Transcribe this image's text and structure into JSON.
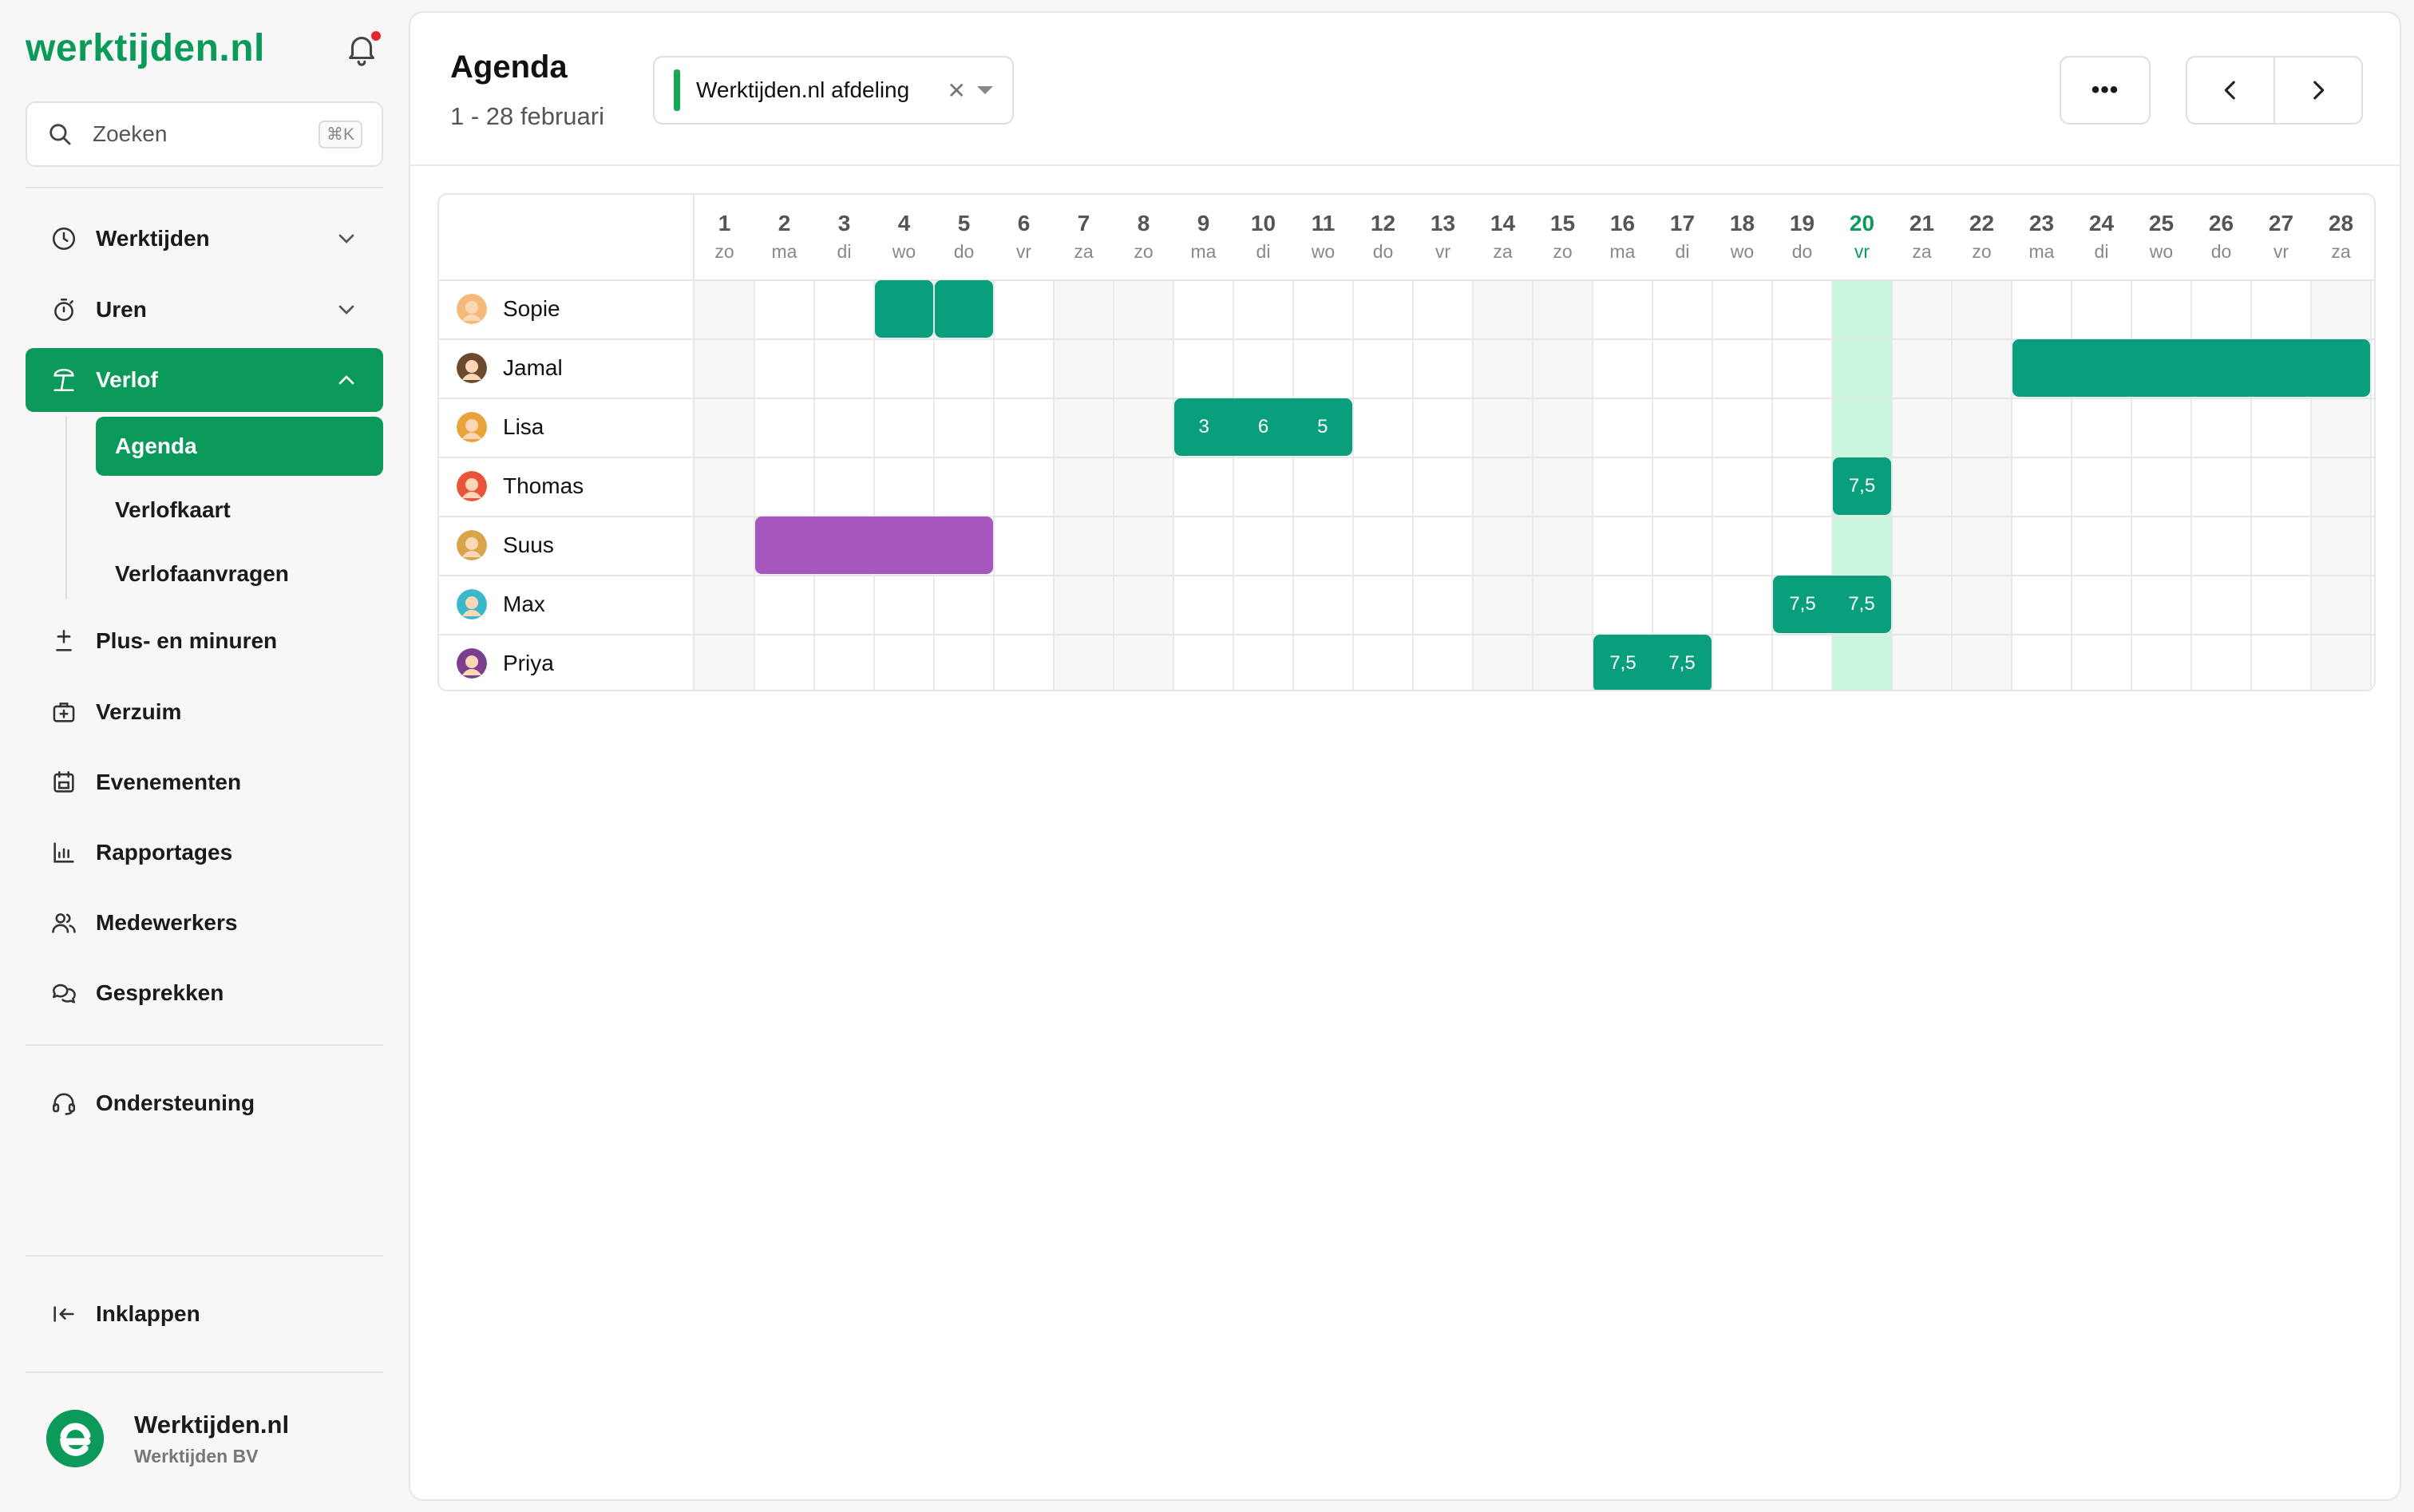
{
  "brand": {
    "logo_text": "werktijden.nl"
  },
  "search": {
    "placeholder": "Zoeken",
    "shortcut": "⌘K"
  },
  "sidebar": {
    "items": [
      {
        "label": "Werktijden",
        "icon": "clock-icon",
        "expandable": true
      },
      {
        "label": "Uren",
        "icon": "stopwatch-icon",
        "expandable": true
      },
      {
        "label": "Verlof",
        "icon": "beach-icon",
        "expandable": true,
        "active": true
      },
      {
        "label": "Plus- en minuren",
        "icon": "plus-minus-icon"
      },
      {
        "label": "Verzuim",
        "icon": "medical-kit-icon"
      },
      {
        "label": "Evenementen",
        "icon": "calendar-icon"
      },
      {
        "label": "Rapportages",
        "icon": "bar-chart-icon"
      },
      {
        "label": "Medewerkers",
        "icon": "users-icon"
      },
      {
        "label": "Gesprekken",
        "icon": "chat-icon"
      }
    ],
    "verlof_sub": [
      {
        "label": "Agenda",
        "active": true
      },
      {
        "label": "Verlofkaart"
      },
      {
        "label": "Verlofaanvragen"
      }
    ],
    "support": "Ondersteuning",
    "collapse": "Inklappen",
    "org": {
      "name": "Werktijden.nl",
      "company": "Werktijden BV"
    }
  },
  "header": {
    "title": "Agenda",
    "range": "1 - 28 februari",
    "filter": {
      "label": "Werktijden.nl afdeling",
      "color": "#17a85a"
    },
    "more_label": "•••"
  },
  "calendar": {
    "today": 20,
    "days": [
      {
        "n": "1",
        "d": "zo"
      },
      {
        "n": "2",
        "d": "ma"
      },
      {
        "n": "3",
        "d": "di"
      },
      {
        "n": "4",
        "d": "wo"
      },
      {
        "n": "5",
        "d": "do"
      },
      {
        "n": "6",
        "d": "vr"
      },
      {
        "n": "7",
        "d": "za"
      },
      {
        "n": "8",
        "d": "zo"
      },
      {
        "n": "9",
        "d": "ma"
      },
      {
        "n": "10",
        "d": "di"
      },
      {
        "n": "11",
        "d": "wo"
      },
      {
        "n": "12",
        "d": "do"
      },
      {
        "n": "13",
        "d": "vr"
      },
      {
        "n": "14",
        "d": "za"
      },
      {
        "n": "15",
        "d": "zo"
      },
      {
        "n": "16",
        "d": "ma"
      },
      {
        "n": "17",
        "d": "di"
      },
      {
        "n": "18",
        "d": "wo"
      },
      {
        "n": "19",
        "d": "do"
      },
      {
        "n": "20",
        "d": "vr"
      },
      {
        "n": "21",
        "d": "za"
      },
      {
        "n": "22",
        "d": "zo"
      },
      {
        "n": "23",
        "d": "ma"
      },
      {
        "n": "24",
        "d": "di"
      },
      {
        "n": "25",
        "d": "wo"
      },
      {
        "n": "26",
        "d": "do"
      },
      {
        "n": "27",
        "d": "vr"
      },
      {
        "n": "28",
        "d": "za"
      }
    ],
    "weekend_days": [
      1,
      7,
      8,
      14,
      15,
      21,
      22,
      28
    ],
    "colors": {
      "leave": "#0a9f7c",
      "special": "#a557bf",
      "today": "#c9f7dd"
    },
    "rows": [
      {
        "name": "Sopie",
        "avatar": "#f5b97a",
        "blocks": [
          {
            "from": 4,
            "to": 4,
            "color": "leave",
            "labels": [
              ""
            ]
          },
          {
            "from": 5,
            "to": 5,
            "color": "leave",
            "labels": [
              ""
            ]
          }
        ]
      },
      {
        "name": "Jamal",
        "avatar": "#6b4a2f",
        "blocks": [
          {
            "from": 23,
            "to": 28,
            "color": "leave",
            "labels": [
              "",
              "",
              "",
              "",
              "",
              ""
            ]
          }
        ]
      },
      {
        "name": "Lisa",
        "avatar": "#e8a33a",
        "blocks": [
          {
            "from": 9,
            "to": 11,
            "color": "leave",
            "labels": [
              "3",
              "6",
              "5"
            ]
          }
        ]
      },
      {
        "name": "Thomas",
        "avatar": "#e8553a",
        "blocks": [
          {
            "from": 20,
            "to": 20,
            "color": "leave",
            "labels": [
              "7,5"
            ]
          }
        ]
      },
      {
        "name": "Suus",
        "avatar": "#d9a44a",
        "blocks": [
          {
            "from": 2,
            "to": 5,
            "color": "special",
            "labels": [
              "",
              "",
              "",
              ""
            ]
          }
        ]
      },
      {
        "name": "Max",
        "avatar": "#3ab8c9",
        "blocks": [
          {
            "from": 19,
            "to": 20,
            "color": "leave",
            "labels": [
              "7,5",
              "7,5"
            ]
          }
        ]
      },
      {
        "name": "Priya",
        "avatar": "#7a3f8f",
        "blocks": [
          {
            "from": 16,
            "to": 17,
            "color": "leave",
            "labels": [
              "7,5",
              "7,5"
            ]
          }
        ]
      }
    ]
  }
}
